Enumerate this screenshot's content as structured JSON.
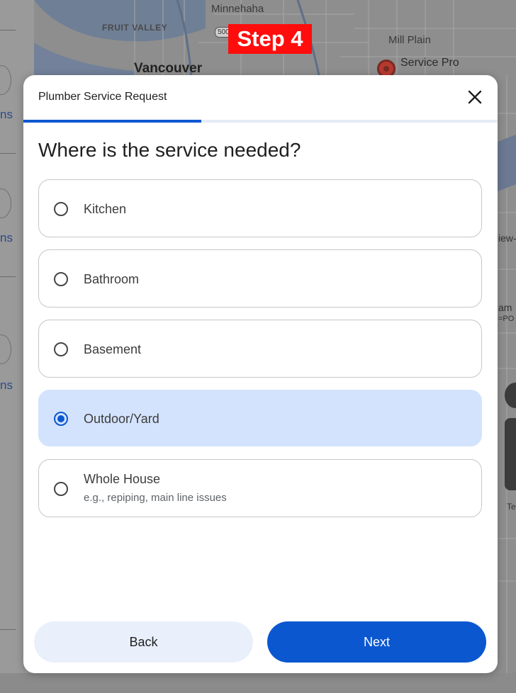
{
  "map": {
    "labels": {
      "minnehaha": "Minnehaha",
      "fruit_valley": "FRUIT VALLEY",
      "vancouver": "Vancouver",
      "mill_plain": "Mill Plain",
      "service_pro": "Service Pro",
      "route": "500"
    },
    "side_left": [
      "ns",
      "ns",
      "ns"
    ],
    "side_right": [
      "iew-",
      "am",
      "=PO",
      "Te"
    ]
  },
  "step_badge": "Step 4",
  "modal": {
    "title": "Plumber Service Request",
    "close_icon": "close-icon",
    "question": "Where is the service needed?",
    "progress": 0.375,
    "options": [
      {
        "label": "Kitchen",
        "selected": false
      },
      {
        "label": "Bathroom",
        "selected": false
      },
      {
        "label": "Basement",
        "selected": false
      },
      {
        "label": "Outdoor/Yard",
        "selected": true
      },
      {
        "label": "Whole House",
        "sub": "e.g., repiping, main line issues",
        "selected": false
      }
    ],
    "back_label": "Back",
    "next_label": "Next"
  },
  "colors": {
    "accent": "#0b57d0",
    "selected_bg": "#d3e3fd",
    "badge": "#ff0d0d"
  }
}
